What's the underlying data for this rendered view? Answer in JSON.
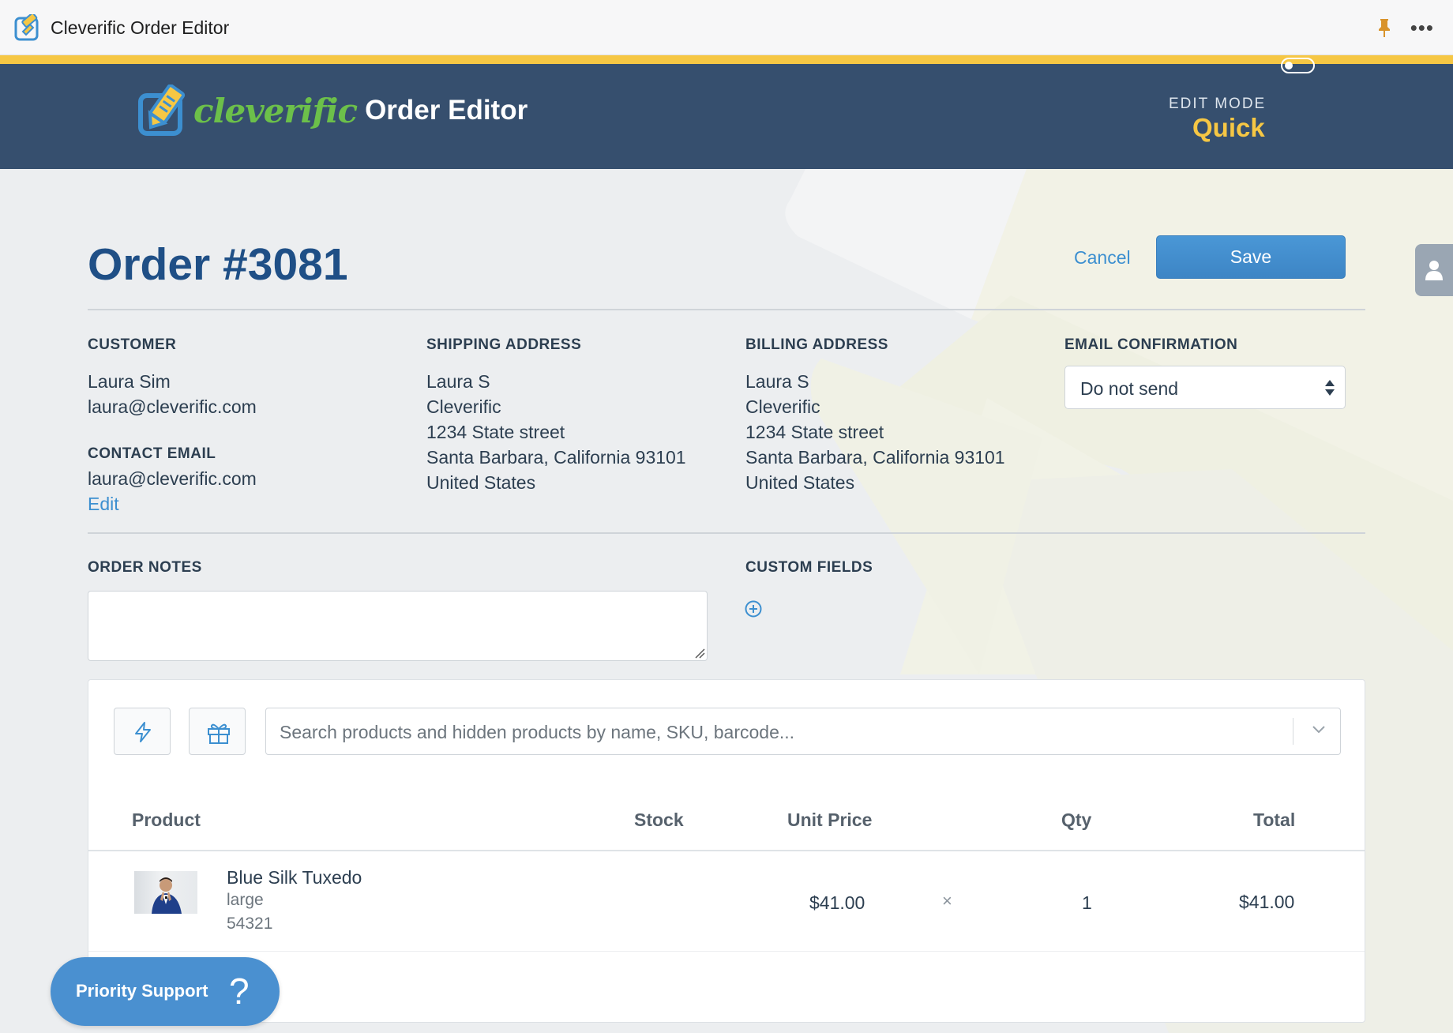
{
  "window": {
    "title": "Cleverific Order Editor",
    "pin_icon": "pin-icon",
    "more_icon": "more-options-icon",
    "more_glyph": "•••"
  },
  "header": {
    "brand_word": "cleverific",
    "brand_suffix": "Order Editor",
    "edit_mode_label": "EDIT MODE",
    "edit_mode_value": "Quick",
    "toggle_on": false,
    "accent_color": "#f6c744",
    "brand_green": "#6cc04a",
    "header_bg": "#364f6e"
  },
  "order": {
    "title": "Order #3081",
    "cancel_label": "Cancel",
    "save_label": "Save"
  },
  "customer": {
    "heading": "CUSTOMER",
    "name": "Laura Sim",
    "email": "laura@cleverific.com",
    "contact_heading": "CONTACT EMAIL",
    "contact_email": "laura@cleverific.com",
    "edit_label": "Edit"
  },
  "shipping": {
    "heading": "SHIPPING ADDRESS",
    "lines": [
      "Laura S",
      "Cleverific",
      "1234 State street",
      "Santa Barbara, California 93101",
      "United States"
    ]
  },
  "billing": {
    "heading": "BILLING ADDRESS",
    "lines": [
      "Laura S",
      "Cleverific",
      "1234 State street",
      "Santa Barbara, California 93101",
      "United States"
    ]
  },
  "email_confirmation": {
    "heading": "EMAIL CONFIRMATION",
    "selected": "Do not send"
  },
  "notes": {
    "heading": "ORDER NOTES",
    "value": ""
  },
  "custom_fields": {
    "heading": "CUSTOM FIELDS"
  },
  "products": {
    "search_placeholder": "Search products and hidden products by name, SKU, barcode...",
    "columns": [
      "Product",
      "Stock",
      "Unit Price",
      "Qty",
      "Total"
    ],
    "rows": [
      {
        "name": "Blue Silk Tuxedo",
        "variant": "large",
        "sku": "54321",
        "stock": "",
        "unit_price": "$41.00",
        "remove_glyph": "×",
        "qty": "1",
        "total": "$41.00"
      }
    ]
  },
  "support": {
    "label": "Priority Support",
    "glyph": "?"
  }
}
